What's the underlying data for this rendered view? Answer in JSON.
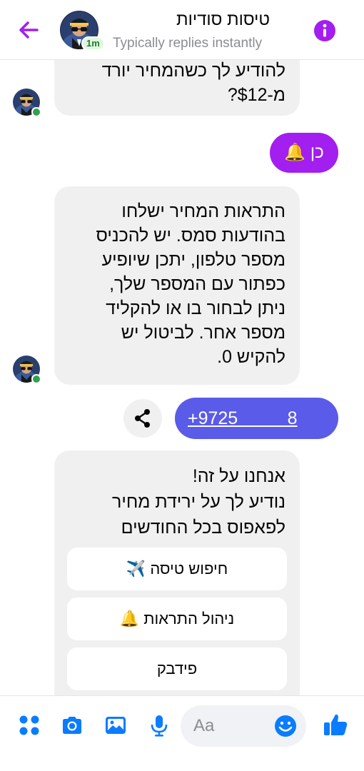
{
  "header": {
    "title": "טיסות סודיות",
    "subtitle": "Typically replies instantly",
    "active_badge": "1m",
    "accent_color": "#a21ff0"
  },
  "messages": {
    "m1_text": "להודיע לך כשהמחיר יורד\nמ-$12?",
    "m2_text": "כן 🔔",
    "m3_text": "התראות המחיר ישלחו\nבהודעות סמס. יש להכניס\nמספר טלפון, יתכן שיופיע\nכפתור עם המספר שלך,\nניתן לבחור בו או להקליד\nמספר אחר. לביטול יש\nלהקיש 0.",
    "m4_phone": "+9725          8",
    "card_text": "אנחנו על זה!\nנודיע לך על ירידת מחיר\nלפאפוס בכל החודשים"
  },
  "quick_replies": [
    {
      "label": "חיפוש טיסה ✈️"
    },
    {
      "label": "ניהול התראות 🔔"
    },
    {
      "label": "פידבק"
    }
  ],
  "composer": {
    "placeholder": "Aa"
  },
  "colors": {
    "sent_bubble_purple": "#a21ff0",
    "sent_bubble_blue": "#5a5be8",
    "received_bubble": "#f0f0f0",
    "toolbar_icon": "#0a7cff"
  },
  "icons": [
    "back-arrow-icon",
    "info-icon",
    "share-icon",
    "apps-icon",
    "camera-icon",
    "gallery-icon",
    "microphone-icon",
    "emoji-icon",
    "thumbs-up-icon"
  ]
}
